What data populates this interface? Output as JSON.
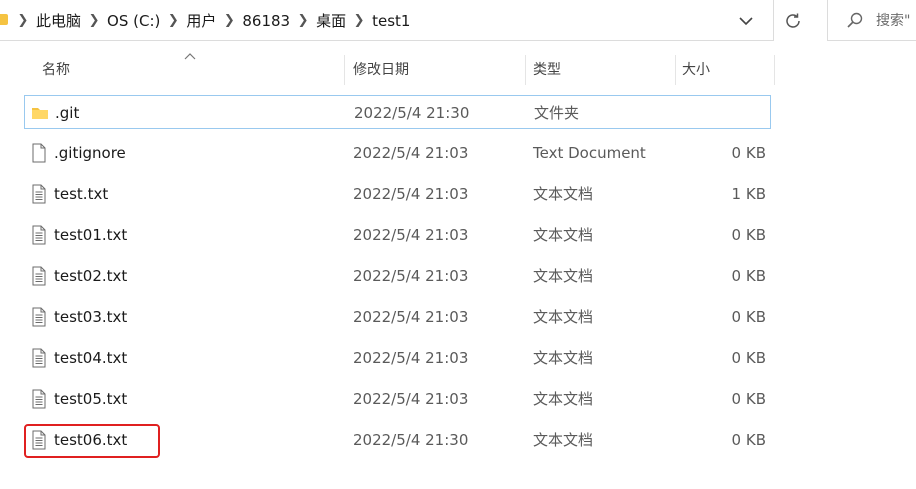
{
  "breadcrumb": [
    "此电脑",
    "OS (C:)",
    "用户",
    "86183",
    "桌面",
    "test1"
  ],
  "search": {
    "placeholder": "搜索\""
  },
  "columns": {
    "name": "名称",
    "modified": "修改日期",
    "type": "类型",
    "size": "大小"
  },
  "files": [
    {
      "name": ".git",
      "modified": "2022/5/4 21:30",
      "type": "文件夹",
      "size": "",
      "icon": "folder-icon",
      "selected": true
    },
    {
      "name": ".gitignore",
      "modified": "2022/5/4 21:03",
      "type": "Text Document",
      "size": "0 KB",
      "icon": "file-icon"
    },
    {
      "name": "test.txt",
      "modified": "2022/5/4 21:03",
      "type": "文本文档",
      "size": "1 KB",
      "icon": "text-file-icon"
    },
    {
      "name": "test01.txt",
      "modified": "2022/5/4 21:03",
      "type": "文本文档",
      "size": "0 KB",
      "icon": "text-file-icon"
    },
    {
      "name": "test02.txt",
      "modified": "2022/5/4 21:03",
      "type": "文本文档",
      "size": "0 KB",
      "icon": "text-file-icon"
    },
    {
      "name": "test03.txt",
      "modified": "2022/5/4 21:03",
      "type": "文本文档",
      "size": "0 KB",
      "icon": "text-file-icon"
    },
    {
      "name": "test04.txt",
      "modified": "2022/5/4 21:03",
      "type": "文本文档",
      "size": "0 KB",
      "icon": "text-file-icon"
    },
    {
      "name": "test05.txt",
      "modified": "2022/5/4 21:03",
      "type": "文本文档",
      "size": "0 KB",
      "icon": "text-file-icon"
    },
    {
      "name": "test06.txt",
      "modified": "2022/5/4 21:30",
      "type": "文本文档",
      "size": "0 KB",
      "icon": "text-file-icon",
      "highlighted": true
    }
  ],
  "colors": {
    "selection_border": "#99c9ef",
    "highlight": "#e02020",
    "folder": "#f5c342"
  }
}
